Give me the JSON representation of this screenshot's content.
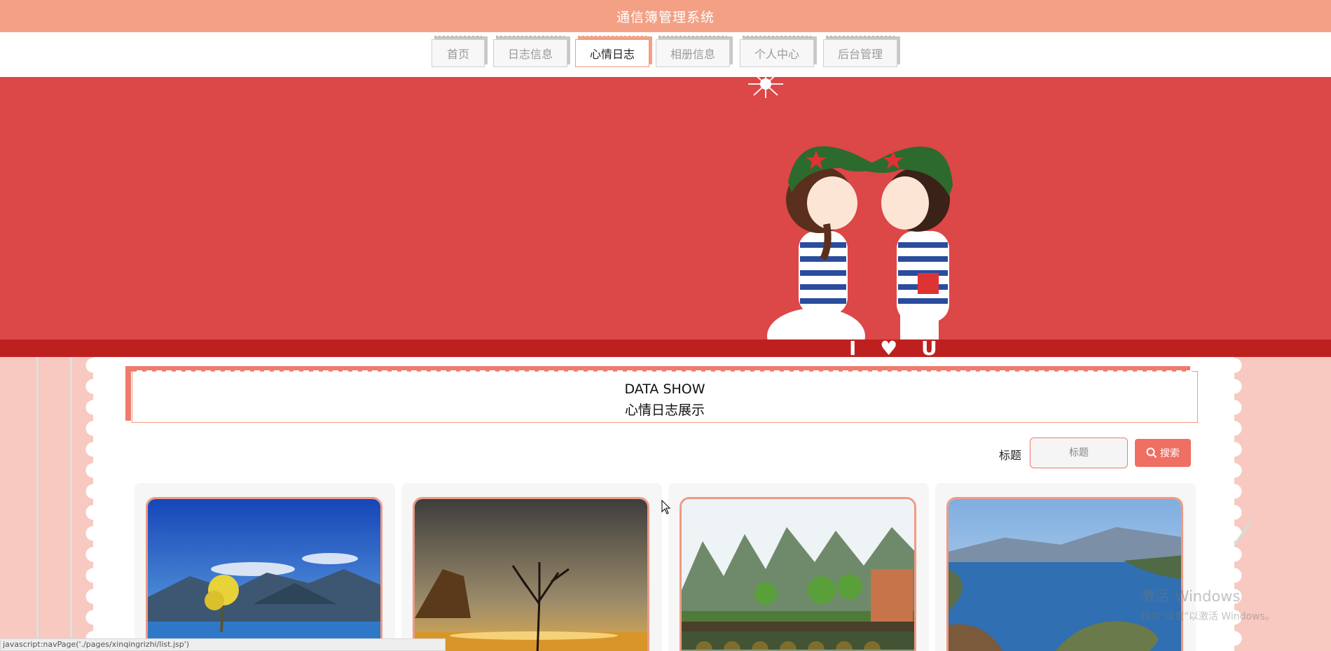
{
  "header": {
    "title": "通信簿管理系统"
  },
  "nav": {
    "items": [
      {
        "label": "首页",
        "active": false
      },
      {
        "label": "日志信息",
        "active": false
      },
      {
        "label": "心情日志",
        "active": true
      },
      {
        "label": "相册信息",
        "active": false
      },
      {
        "label": "个人中心",
        "active": false
      },
      {
        "label": "后台管理",
        "active": false
      }
    ]
  },
  "banner": {
    "text": "I ♥ U"
  },
  "section": {
    "title_en": "DATA SHOW",
    "title_zh": "心情日志展示"
  },
  "search": {
    "label": "标题",
    "placeholder": "标题",
    "button_label": "搜索",
    "button_icon": "search-icon"
  },
  "cards": [
    {
      "image": "lake-tree-blue-sky"
    },
    {
      "image": "sunset-tree-lake"
    },
    {
      "image": "mountains-bridge-village"
    },
    {
      "image": "lake-island-mountains"
    }
  ],
  "status_bar": {
    "text": "javascript:navPage('./pages/xinqingrizhi/list.jsp')"
  },
  "watermark": {
    "line1": "激活 Windows",
    "line2": "转到\"设置\"以激活 Windows。"
  },
  "colors": {
    "primary": "#f3a085",
    "accent": "#ef6f63",
    "banner": "#dc4747"
  }
}
